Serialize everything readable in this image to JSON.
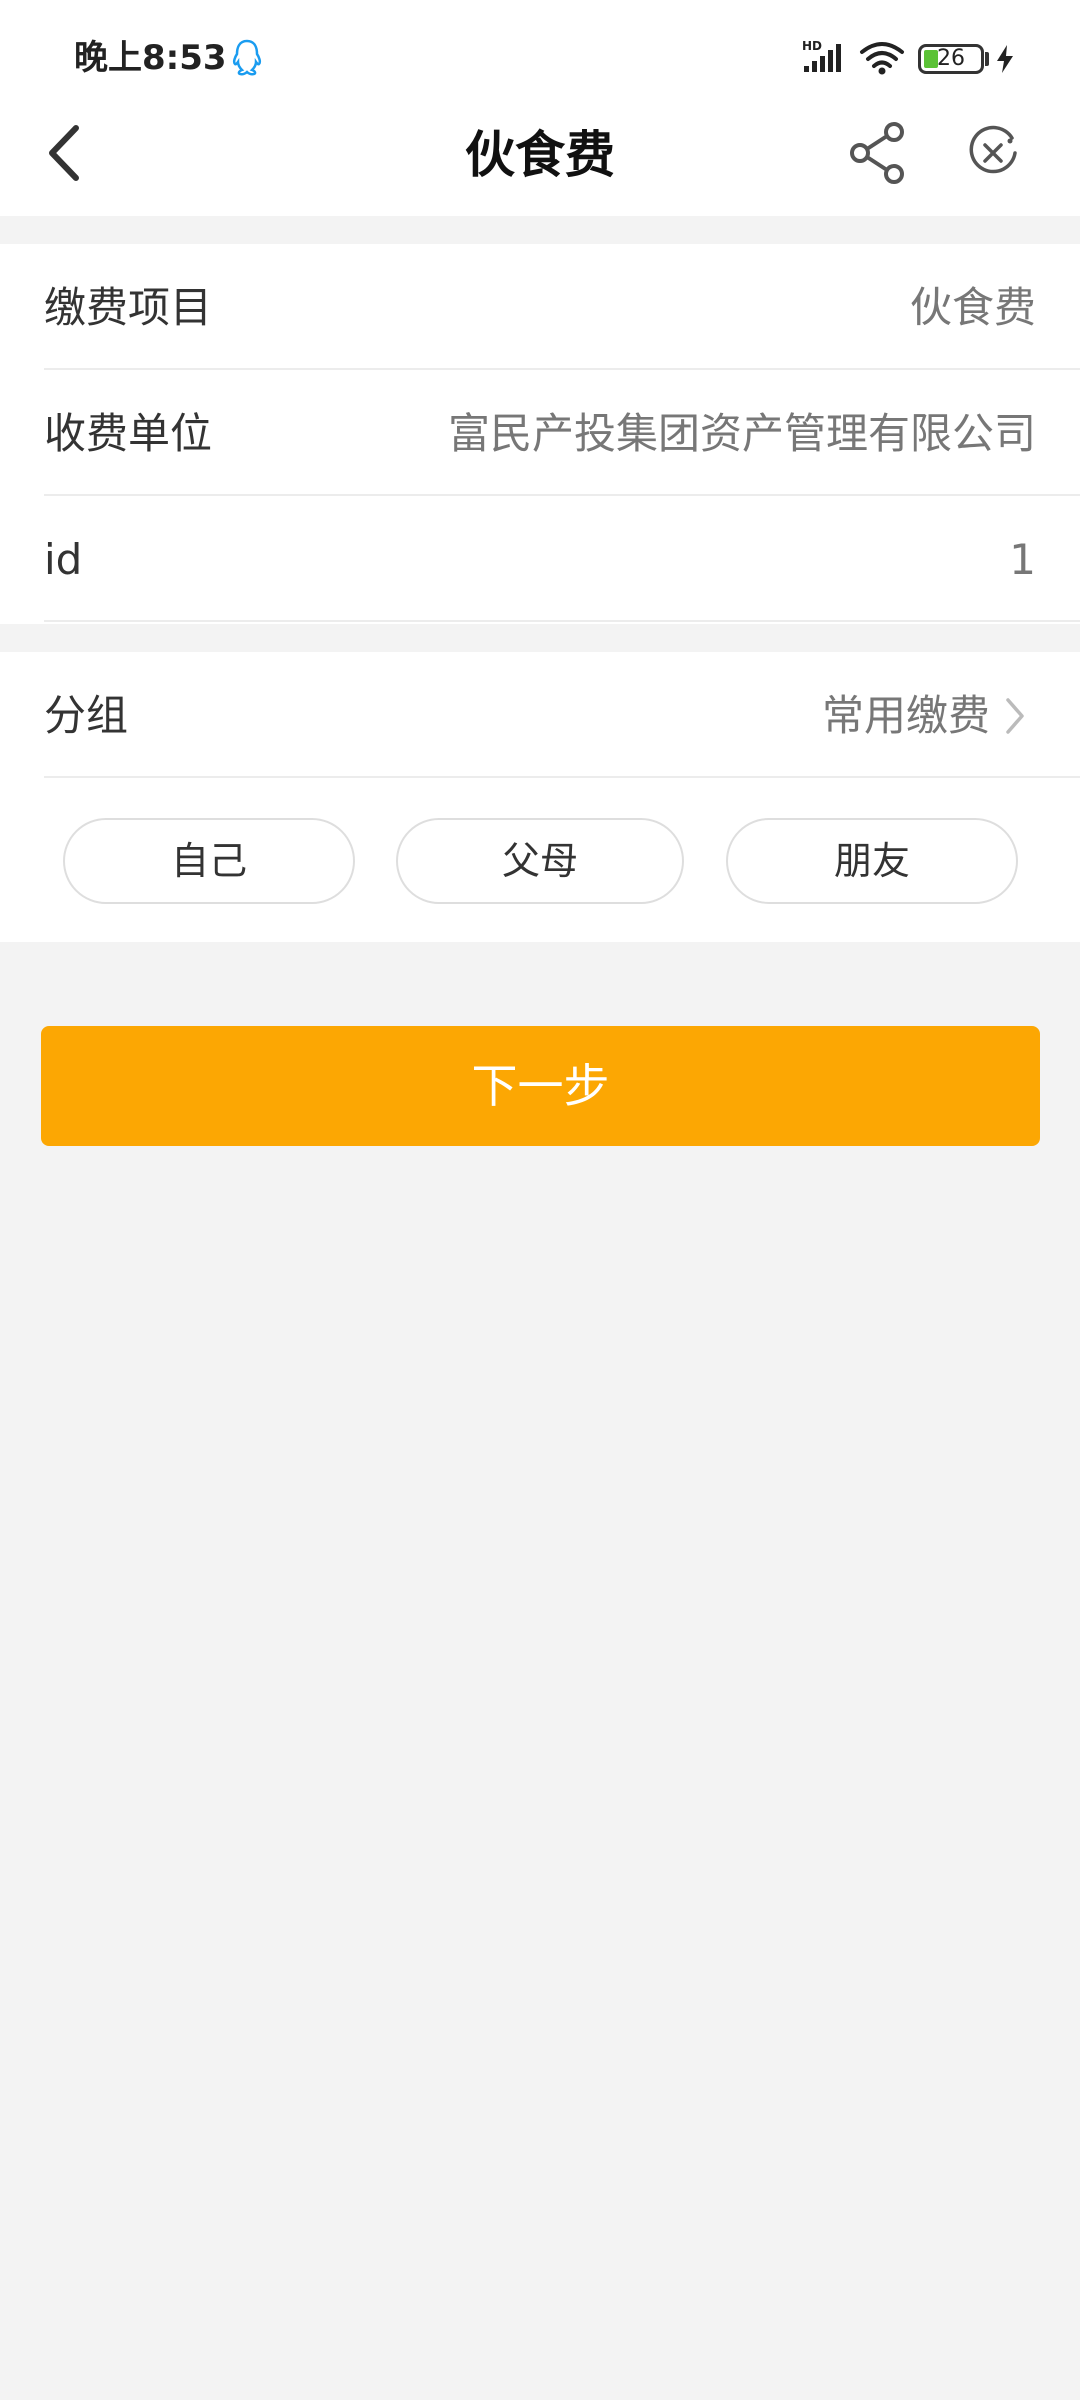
{
  "status_bar": {
    "time": "晚上8:53",
    "battery_level": "26",
    "icons": [
      "qq-icon",
      "hd-signal-icon",
      "wifi-icon",
      "battery-icon",
      "charging-bolt-icon"
    ]
  },
  "nav": {
    "title": "伙食费",
    "icons": [
      "back-arrow-icon",
      "share-icon",
      "close-circle-icon"
    ]
  },
  "details": [
    {
      "label": "缴费项目",
      "value": "伙食费"
    },
    {
      "label": "收费单位",
      "value": "富民产投集团资产管理有限公司"
    },
    {
      "label": "id",
      "value": "1"
    }
  ],
  "group": {
    "label": "分组",
    "value": "常用缴费",
    "options": [
      "自己",
      "父母",
      "朋友"
    ]
  },
  "next_button": "下一步",
  "colors": {
    "accent": "#fca703",
    "background": "#f3f3f3",
    "card": "#ffffff",
    "battery_fill": "#5bc236"
  }
}
